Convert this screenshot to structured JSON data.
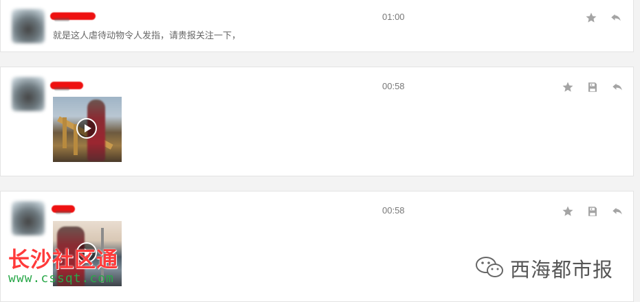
{
  "messages": [
    {
      "time": "01:00",
      "text": "就是这人虐待动物令人发指，请贵报关注一下，",
      "actions": [
        "star-icon",
        "reply-icon"
      ]
    },
    {
      "time": "00:58",
      "text": "",
      "media": "video",
      "actions": [
        "star-icon",
        "save-icon",
        "reply-icon"
      ]
    },
    {
      "time": "00:58",
      "text": "",
      "media": "video",
      "actions": [
        "star-icon",
        "save-icon",
        "reply-icon"
      ]
    }
  ],
  "watermarks": {
    "left_title": "长沙社区通",
    "left_url": "www.cssqt.com",
    "right_text": "西海都市报"
  },
  "colors": {
    "redaction": "#e11111",
    "icon": "#a4a4a4",
    "watermark_red": "#ff3a3a",
    "watermark_green": "#2aa84a"
  }
}
